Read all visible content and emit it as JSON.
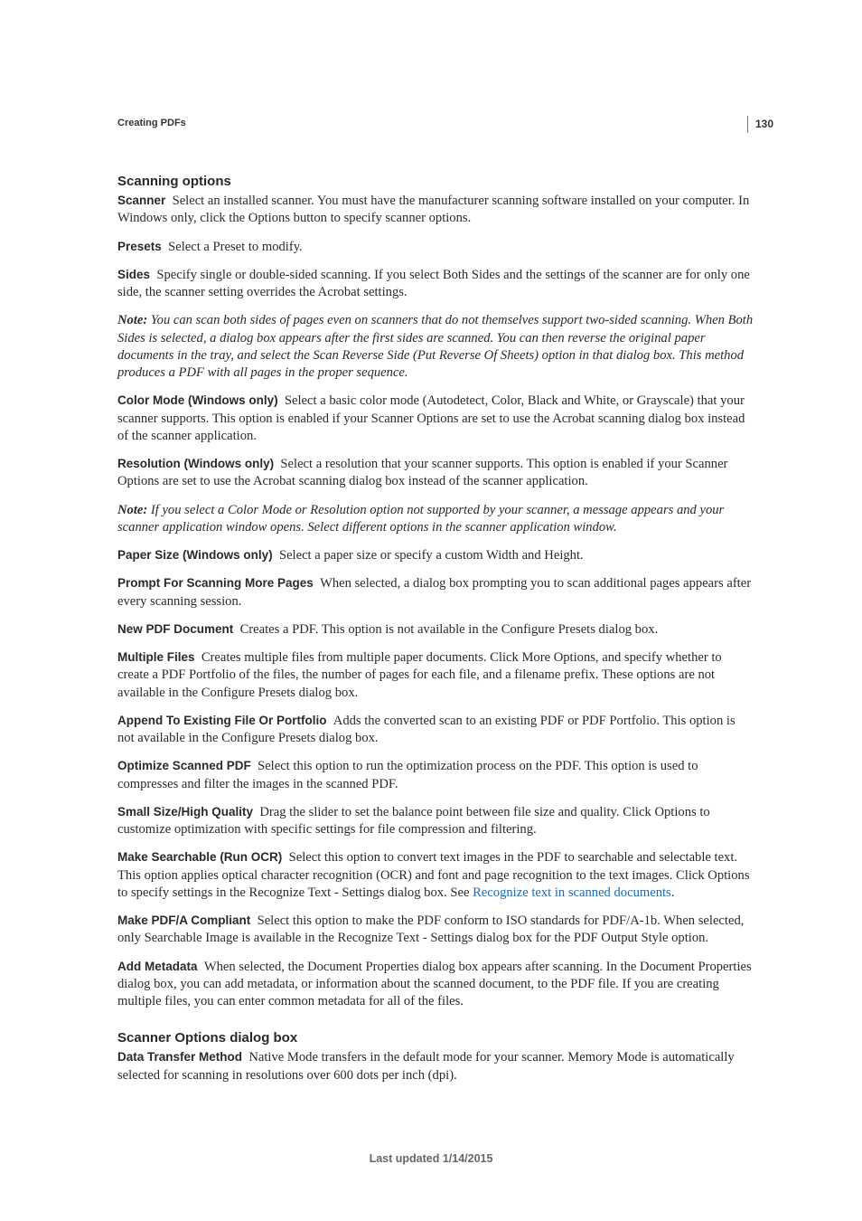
{
  "page_number": "130",
  "chapter": "Creating PDFs",
  "sections": {
    "scanning": {
      "title": "Scanning options",
      "scanner_label": "Scanner",
      "scanner_text": "Select an installed scanner. You must have the manufacturer scanning software installed on your computer. In Windows only, click the Options button to specify scanner options.",
      "presets_label": "Presets",
      "presets_text": "Select a Preset to modify.",
      "sides_label": "Sides",
      "sides_text": "Specify single or double-sided scanning. If you select Both Sides and the settings of the scanner are for only one side, the scanner setting overrides the Acrobat settings.",
      "note1_label": "Note:",
      "note1_text": "You can scan both sides of pages even on scanners that do not themselves support two-sided scanning. When Both Sides is selected, a dialog box appears after the first sides are scanned. You can then reverse the original paper documents in the tray, and select the Scan Reverse Side (Put Reverse Of Sheets) option in that dialog box. This method produces a PDF with all pages in the proper sequence.",
      "color_label": "Color Mode (Windows only)",
      "color_text": "Select a basic color mode (Autodetect, Color, Black and White, or Grayscale) that your scanner supports. This option is enabled if your Scanner Options are set to use the Acrobat scanning dialog box instead of the scanner application.",
      "reso_label": "Resolution (Windows only)",
      "reso_text": "Select a resolution that your scanner supports. This option is enabled if your Scanner Options are set to use the Acrobat scanning dialog box instead of the scanner application.",
      "note2_label": "Note:",
      "note2_text": "If you select a Color Mode or Resolution option not supported by your scanner, a message appears and your scanner application window opens. Select different options in the scanner application window.",
      "paper_label": "Paper Size (Windows only)",
      "paper_text": "Select a paper size or specify a custom Width and Height.",
      "prompt_label": "Prompt For Scanning More Pages",
      "prompt_text": "When selected, a dialog box prompting you to scan additional pages appears after every scanning session.",
      "newpdf_label": "New PDF Document",
      "newpdf_text": "Creates a PDF. This option is not available in the Configure Presets dialog box.",
      "multi_label": "Multiple Files",
      "multi_text": "Creates multiple files from multiple paper documents. Click More Options, and specify whether to create a PDF Portfolio of the files, the number of pages for each file, and a filename prefix. These options are not available in the Configure Presets dialog box.",
      "append_label": "Append To Existing File Or Portfolio",
      "append_text": "Adds the converted scan to an existing PDF or PDF Portfolio. This option is not available in the Configure Presets dialog box.",
      "optimize_label": "Optimize Scanned PDF",
      "optimize_text": "Select this option to run the optimization process on the PDF. This option is used to compresses and filter the images in the scanned PDF.",
      "small_label": "Small Size/High Quality",
      "small_text": "Drag the slider to set the balance point between file size and quality. Click Options to customize optimization with specific settings for file compression and filtering.",
      "search_label": "Make Searchable (Run OCR)",
      "search_text_a": "Select this option to convert text images in the PDF to searchable and selectable text. This option applies optical character recognition (OCR) and font and page recognition to the text images. Click Options to specify settings in the Recognize Text - Settings dialog box. See ",
      "search_link": "Recognize text in scanned documents",
      "search_text_b": ".",
      "pdfa_label": "Make PDF/A Compliant",
      "pdfa_text": "Select this option to make the PDF conform to ISO standards for PDF/A-1b. When selected, only Searchable Image is available in the Recognize Text - Settings dialog box for the PDF Output Style option.",
      "meta_label": "Add Metadata",
      "meta_text": "When selected, the Document Properties dialog box appears after scanning. In the Document Properties dialog box, you can add metadata, or information about the scanned document, to the PDF file. If you are creating multiple files, you can enter common metadata for all of the files."
    },
    "scanner_opts": {
      "title": "Scanner Options dialog box",
      "dtm_label": "Data Transfer Method",
      "dtm_text": "Native Mode transfers in the default mode for your scanner. Memory Mode is automatically selected for scanning in resolutions over 600 dots per inch (dpi)."
    }
  },
  "footer": "Last updated 1/14/2015"
}
